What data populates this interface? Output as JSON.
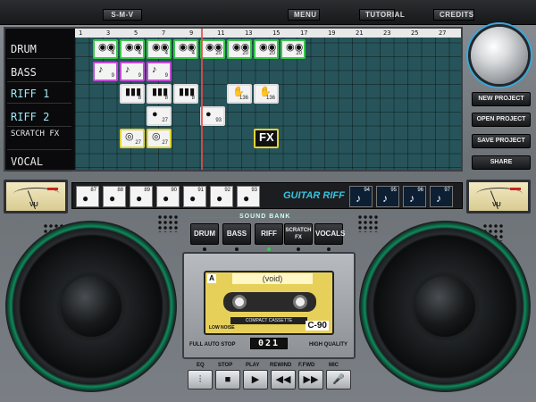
{
  "top_menu": {
    "logo": "S-M-V",
    "menu": "MENU",
    "tutorial": "TUTORIAL",
    "credits": "CREDITS"
  },
  "tracks": {
    "labels": [
      "DRUM",
      "BASS",
      "RIFF 1",
      "RIFF 2",
      "SCRATCH FX",
      "VOCAL"
    ]
  },
  "ruler": {
    "ticks": [
      "1",
      "3",
      "5",
      "7",
      "9",
      "11",
      "13",
      "15",
      "17",
      "19",
      "21",
      "23",
      "25",
      "27"
    ]
  },
  "clips": {
    "drum": [
      "4",
      "4",
      "4",
      "4",
      "20",
      "20",
      "20",
      "20"
    ],
    "bass": [
      "9",
      "9",
      "9"
    ],
    "riff1": [
      "8",
      "8",
      "8",
      "136",
      "136"
    ],
    "riff2": [
      "27",
      "93"
    ],
    "scratch": [
      "27",
      "27",
      "FX"
    ]
  },
  "right_panel": {
    "new_project": "NEW PROJECT",
    "open_project": "OPEN PROJECT",
    "save_project": "SAVE PROJECT",
    "share": "SHARE"
  },
  "vu": {
    "label": "VU"
  },
  "sample_strip": {
    "numbers_left": [
      "87",
      "88",
      "89",
      "90",
      "91",
      "92",
      "93"
    ],
    "title": "GUITAR RIFF",
    "numbers_right": [
      "94",
      "95",
      "96",
      "97"
    ]
  },
  "sound_bank": {
    "title": "SOUND BANK",
    "buttons": [
      "DRUM",
      "BASS",
      "RIFF",
      "SCRATCH FX",
      "VOCALS"
    ]
  },
  "deck": {
    "cassette_side": "A",
    "cassette_title": "(void)",
    "cassette_brand": "COMPACT CASSETTE",
    "cassette_type": "C-90",
    "low_noise": "LOW NOISE",
    "full_auto_stop": "FULL AUTO STOP",
    "high_quality": "HIGH QUALITY",
    "counter": "021"
  },
  "transport": {
    "labels": [
      "EQ",
      "STOP",
      "PLAY",
      "REWIND",
      "F.FWD",
      "MIC"
    ]
  }
}
